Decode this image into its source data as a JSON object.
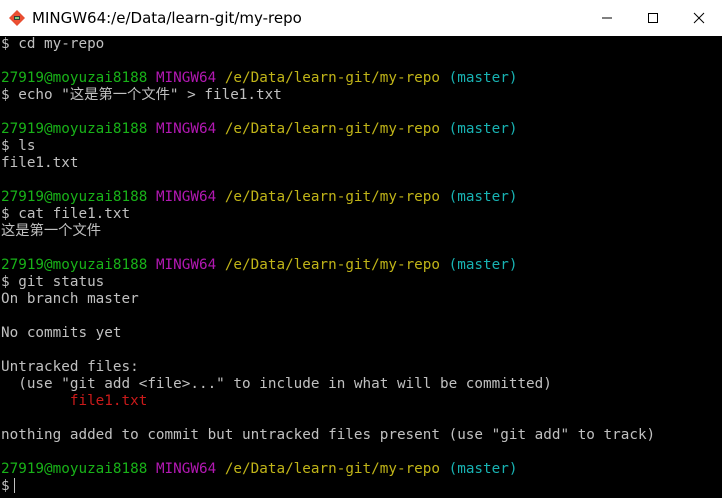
{
  "window": {
    "title": "MINGW64:/e/Data/learn-git/my-repo"
  },
  "prompt": {
    "user_host": "27919@moyuzai8188",
    "shell": "MINGW64",
    "path": "/e/Data/learn-git/my-repo",
    "branch": "(master)",
    "symbol": "$"
  },
  "terminal": {
    "cmd_cd": "$ cd my-repo",
    "cmd_echo": "$ echo \"这是第一个文件\" > file1.txt",
    "cmd_ls": "$ ls",
    "out_ls": "file1.txt",
    "cmd_cat": "$ cat file1.txt",
    "out_cat": "这是第一个文件",
    "cmd_status": "$ git status",
    "status_branch": "On branch master",
    "status_nocommits": "No commits yet",
    "status_untracked": "Untracked files:",
    "status_hint": "  (use \"git add <file>...\" to include in what will be committed)",
    "status_file": "        file1.txt",
    "status_nothing": "nothing added to commit but untracked files present (use \"git add\" to track)"
  },
  "colors": {
    "user_host": "#18b218",
    "shell": "#b218b2",
    "path": "#c0b418",
    "branch": "#18b2b2",
    "untracked_file": "#ca1a1a",
    "text": "#c0c0c0",
    "background": "#000000"
  },
  "icons": {
    "app": "git-bash-icon",
    "minimize": "minimize-icon",
    "maximize": "maximize-icon",
    "close": "close-icon"
  }
}
